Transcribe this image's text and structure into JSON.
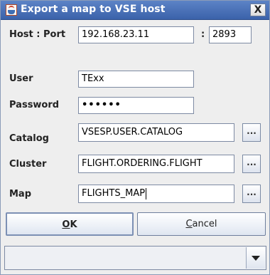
{
  "window": {
    "title": "Export a map to VSE host",
    "close_label": "X"
  },
  "form": {
    "host_port_label": "Host : Port",
    "host_value": "192.168.23.11",
    "port_sep": ":",
    "port_value": "2893",
    "user_label": "User",
    "user_value": "TExx",
    "password_label": "Password",
    "password_value": "••••••",
    "catalog_label": "Catalog",
    "catalog_value": "VSESP.USER.CATALOG",
    "cluster_label": "Cluster",
    "cluster_value": "FLIGHT.ORDERING.FLIGHT",
    "map_label": "Map",
    "map_value": "FLIGHTS_MAP",
    "browse_label": "..."
  },
  "buttons": {
    "ok_mnemonic": "O",
    "ok_rest": "K",
    "cancel_mnemonic": "C",
    "cancel_rest": "ancel"
  },
  "combo": {
    "value": ""
  },
  "colors": {
    "titlebar": "#4a72b8",
    "background": "#eeeeee"
  },
  "icons": {
    "app": "java-cup-icon",
    "dropdown": "chevron-down-icon"
  }
}
